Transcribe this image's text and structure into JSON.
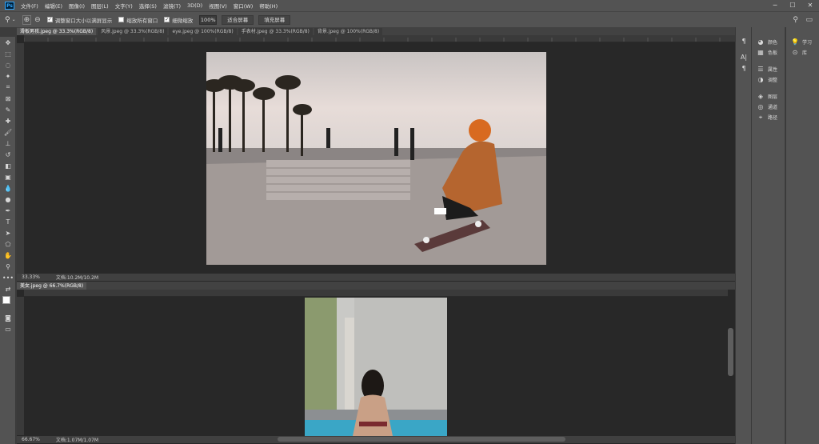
{
  "app": {
    "logo": "Ps"
  },
  "menu": [
    "文件(F)",
    "编辑(E)",
    "图像(I)",
    "图层(L)",
    "文字(Y)",
    "选择(S)",
    "滤镜(T)",
    "3D(D)",
    "视图(V)",
    "窗口(W)",
    "帮助(H)"
  ],
  "options": {
    "chk1": "调整窗口大小以满屏显示",
    "chk2": "缩放所有窗口",
    "chk3": "细微缩放",
    "zoom": "100%",
    "btn_fit": "适合屏幕",
    "btn_fill": "填充屏幕"
  },
  "tabs_top": [
    "滑板男孩.jpeg @ 33.3%(RGB/8)",
    "风景.jpeg @ 33.3%(RGB/8)",
    "eye.jpeg @ 100%(RGB/8)",
    "手表材.jpeg @ 33.3%(RGB/8)",
    "背景.jpeg @ 100%(RGB/8)"
  ],
  "tabs_bottom": [
    "美女.jpeg @ 66.7%(RGB/8)"
  ],
  "status_top": {
    "zoom": "33.33%",
    "doc": "文档:10.2M/10.2M"
  },
  "status_bottom": {
    "zoom": "66.67%",
    "doc": "文档:1.07M/1.07M"
  },
  "panels_right": [
    {
      "icon": "color-icon",
      "label": "颜色"
    },
    {
      "icon": "swatches-icon",
      "label": "色板"
    },
    {
      "icon": "properties-icon",
      "label": "属性"
    },
    {
      "icon": "adjustments-icon",
      "label": "调整"
    },
    {
      "icon": "layers-icon",
      "label": "图层"
    },
    {
      "icon": "channels-icon",
      "label": "通道"
    },
    {
      "icon": "paths-icon",
      "label": "路径"
    }
  ],
  "panels_far": [
    {
      "icon": "learn-icon",
      "label": "学习"
    },
    {
      "icon": "libraries-icon",
      "label": "库"
    }
  ],
  "colors": {
    "bg_dark": "#282828",
    "chrome": "#535353",
    "accent_blue": "#31a8ff"
  }
}
